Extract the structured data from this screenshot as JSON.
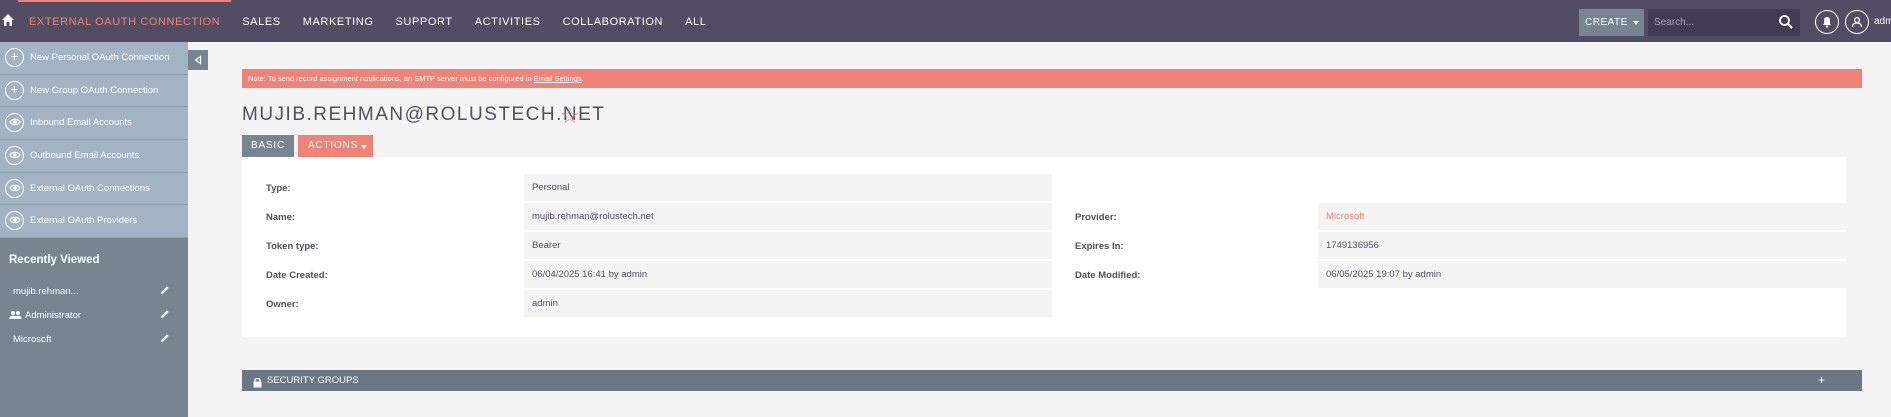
{
  "topbar": {
    "home_icon": "home-icon",
    "nav": [
      {
        "label": "EXTERNAL OAUTH CONNECTION",
        "active": true
      },
      {
        "label": "SALES",
        "active": false
      },
      {
        "label": "MARKETING",
        "active": false
      },
      {
        "label": "SUPPORT",
        "active": false
      },
      {
        "label": "ACTIVITIES",
        "active": false
      },
      {
        "label": "COLLABORATION",
        "active": false
      },
      {
        "label": "ALL",
        "active": false
      }
    ],
    "create_label": "CREATE",
    "search_placeholder": "Search...",
    "user_label": "adm"
  },
  "sidebar": {
    "actions": [
      {
        "label": "New Personal OAuth Connection",
        "icon": "plus-icon"
      },
      {
        "label": "New Group OAuth Connection",
        "icon": "plus-icon"
      },
      {
        "label": "Inbound Email Accounts",
        "icon": "eye-icon"
      },
      {
        "label": "Outbound Email Accounts",
        "icon": "eye-icon"
      },
      {
        "label": "External OAuth Connections",
        "icon": "eye-icon"
      },
      {
        "label": "External OAuth Providers",
        "icon": "eye-icon"
      }
    ],
    "recently_viewed_title": "Recently Viewed",
    "recently_viewed": [
      {
        "label": "mujib.rehman...",
        "icon": ""
      },
      {
        "label": "Administrator",
        "icon": "users-icon"
      },
      {
        "label": "Microsoft",
        "icon": ""
      }
    ]
  },
  "notice": {
    "text": "Note: To send record assignment notifications, an SMTP server must be configured in ",
    "link": "Email Settings",
    "suffix": "."
  },
  "record": {
    "title": "MUJIB.REHMAN@ROLUSTECH.NET",
    "tab_basic": "BASIC",
    "tab_actions": "ACTIONS",
    "fields": {
      "type_label": "Type:",
      "type_value": "Personal",
      "name_label": "Name:",
      "name_value": "mujib.rehman@rolustech.net",
      "token_type_label": "Token type:",
      "token_type_value": "Bearer",
      "date_created_label": "Date Created:",
      "date_created_value": "06/04/2025 16:41 by admin",
      "owner_label": "Owner:",
      "owner_value": "admin",
      "provider_label": "Provider:",
      "provider_value": "Microsoft",
      "expires_in_label": "Expires In:",
      "expires_in_value": "1749136956",
      "date_modified_label": "Date Modified:",
      "date_modified_value": "06/05/2025 19:07 by admin"
    }
  },
  "security_groups": {
    "label": "SECURITY GROUPS",
    "toggle": "+"
  },
  "colors": {
    "topbar": "#534d64",
    "accent": "#f08377",
    "sidebar": "#778591",
    "sidebar_actions": "#a3b3c3"
  }
}
